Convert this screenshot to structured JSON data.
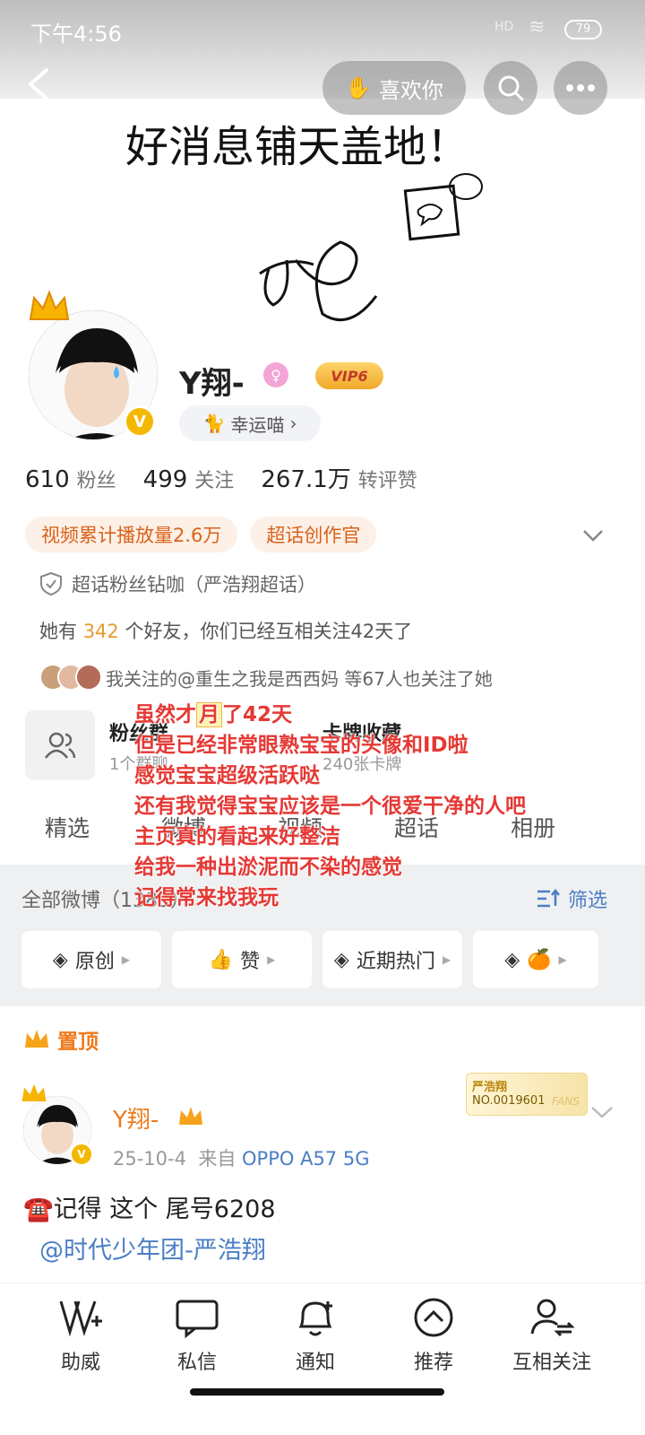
{
  "status_bar": {
    "time": "下午4:56",
    "signal": "HD",
    "battery": "79"
  },
  "header": {
    "like_button": "喜欢你"
  },
  "profile": {
    "name": "Y翔-",
    "vip": "VIP6",
    "lucky": "幸运喵",
    "stats": [
      {
        "num": "610",
        "label": "粉丝"
      },
      {
        "num": "499",
        "label": "关注"
      },
      {
        "num": "267.1万",
        "label": "转评赞"
      }
    ],
    "tags": [
      "视频累计播放量2.6万",
      "超话创作官"
    ],
    "superchat": "超话粉丝钻咖（严浩翔超话）",
    "friends_prefix": "她有",
    "friends_count": "342",
    "friends_suffix": "个好友，你们已经互相关注42天了",
    "mutual_follow": "我关注的@重生之我是西西妈 等67人也关注了她"
  },
  "cards": {
    "fans_group_title": "粉丝群",
    "fans_group_sub": "1个群聊",
    "card_title": "卡牌收藏",
    "card_sub": "240张卡牌"
  },
  "tabs": [
    "精选",
    "微博",
    "视频",
    "超话",
    "相册"
  ],
  "feed_header": {
    "all": "全部微博（1389）",
    "filter": "筛选"
  },
  "chips": [
    "原创",
    "赞",
    "近期热门"
  ],
  "pinned_label": "置顶",
  "post": {
    "name": "Y翔-",
    "date": "25-10-4",
    "from": "来自",
    "device": "OPPO A57 5G",
    "text": "☎️记得 这个 尾号6208",
    "mention": "@时代少年团-严浩翔",
    "fans_card": {
      "line1": "严浩翔",
      "line2": "NO.0019601",
      "line3": "FANS"
    }
  },
  "overlay_text": {
    "line1_pre": "虽然才",
    "line1_box": "月",
    "line1_post": "了42天",
    "line2": "但是已经非常眼熟宝宝的头像和ID啦",
    "line3": "感觉宝宝超级活跃哒",
    "line4": "还有我觉得宝宝应该是一个很爱干净的人吧",
    "line5": "主页真的看起来好整洁",
    "line6": "给我一种出淤泥而不染的感觉",
    "line7": "记得常来找我玩"
  },
  "signature": {
    "text": "好消息铺天盖地！"
  },
  "bottom_nav": [
    "助威",
    "私信",
    "通知",
    "推荐",
    "互相关注"
  ],
  "colors": {
    "accent": "#ef7a1a",
    "link": "#4b7ec5",
    "overlay": "#e53935"
  }
}
